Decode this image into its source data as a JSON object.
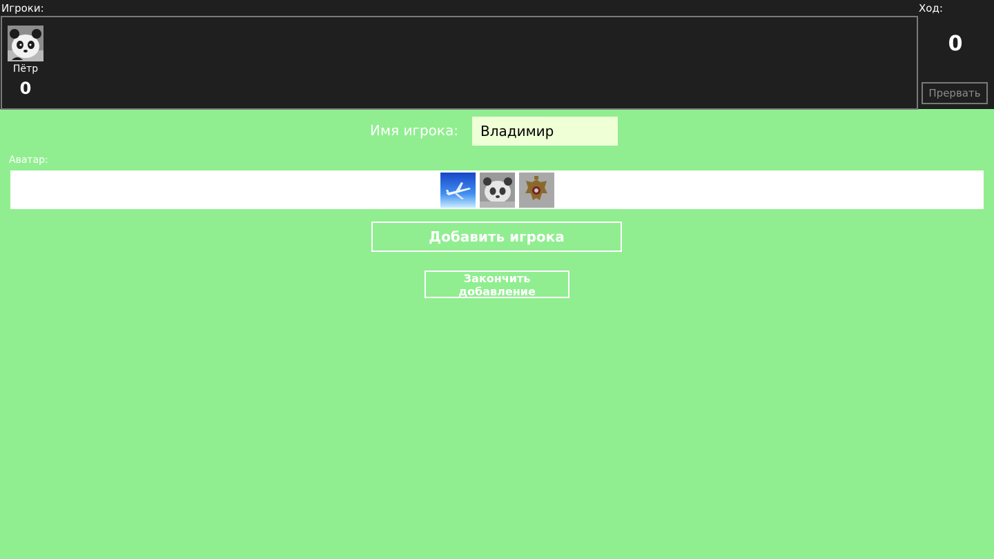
{
  "header": {
    "players_label": "Игроки:",
    "turn_label": "Ход:",
    "turn_value": "0",
    "abort_label": "Прервать"
  },
  "players": [
    {
      "name": "Пётр",
      "score": "0",
      "avatar": "panda-icon"
    }
  ],
  "form": {
    "name_label": "Имя игрока:",
    "name_value": "Владимир",
    "avatar_label": "Аватар:",
    "avatar_options": [
      "airplane-icon",
      "panda-icon",
      "coat-of-arms-icon"
    ],
    "add_button_label": "Добавить игрока",
    "finish_button_label": "Закончить добавление"
  },
  "colors": {
    "background": "#90ee90",
    "topbar": "#1f1f1f",
    "input_background": "#efffd6",
    "button_border": "#ffffff"
  }
}
